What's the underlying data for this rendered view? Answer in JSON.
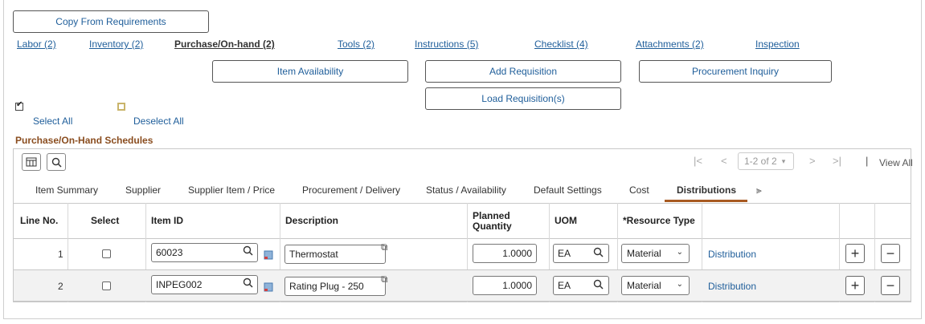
{
  "top": {
    "copy_button": "Copy From Requirements"
  },
  "tabs_nav": [
    {
      "label": "Labor (2)"
    },
    {
      "label": "Inventory (2)"
    },
    {
      "label": "Purchase/On-hand (2)"
    },
    {
      "label": "Tools (2)"
    },
    {
      "label": "Instructions (5)"
    },
    {
      "label": "Checklist (4)"
    },
    {
      "label": "Attachments (2)"
    },
    {
      "label": "Inspection"
    }
  ],
  "actions": {
    "item_availability": "Item Availability",
    "add_requisition": "Add Requisition",
    "procurement_inquiry": "Procurement Inquiry",
    "load_requisitions": "Load Requisition(s)"
  },
  "selection": {
    "select_all": "Select All",
    "deselect_all": "Deselect All"
  },
  "grid": {
    "title": "Purchase/On-Hand Schedules",
    "pager": {
      "first": "|<",
      "prev": "<",
      "range": "1-2 of 2",
      "next": ">",
      "last": ">|",
      "sep": "|",
      "view_all": "View All"
    },
    "tabs": [
      {
        "label": "Item Summary"
      },
      {
        "label": "Supplier"
      },
      {
        "label": "Supplier Item / Price"
      },
      {
        "label": "Procurement / Delivery"
      },
      {
        "label": "Status / Availability"
      },
      {
        "label": "Default Settings"
      },
      {
        "label": "Cost"
      },
      {
        "label": "Distributions"
      }
    ],
    "columns": {
      "line_no": "Line No.",
      "select": "Select",
      "item_id": "Item ID",
      "description": "Description",
      "planned_qty_1": "Planned",
      "planned_qty_2": "Quantity",
      "uom": "UOM",
      "resource_type": "*Resource Type"
    },
    "rows": [
      {
        "line": "1",
        "item_id": "60023",
        "description": "Thermostat",
        "qty": "1.0000",
        "uom": "EA",
        "resource_type": "Material",
        "link": "Distribution"
      },
      {
        "line": "2",
        "item_id": "INPEG002",
        "description": "Rating Plug - 250",
        "qty": "1.0000",
        "uom": "EA",
        "resource_type": "Material",
        "link": "Distribution"
      }
    ]
  },
  "colors": {
    "link": "#1f5e9a",
    "accent": "#a85a21",
    "section_title": "#8a4d1f"
  }
}
